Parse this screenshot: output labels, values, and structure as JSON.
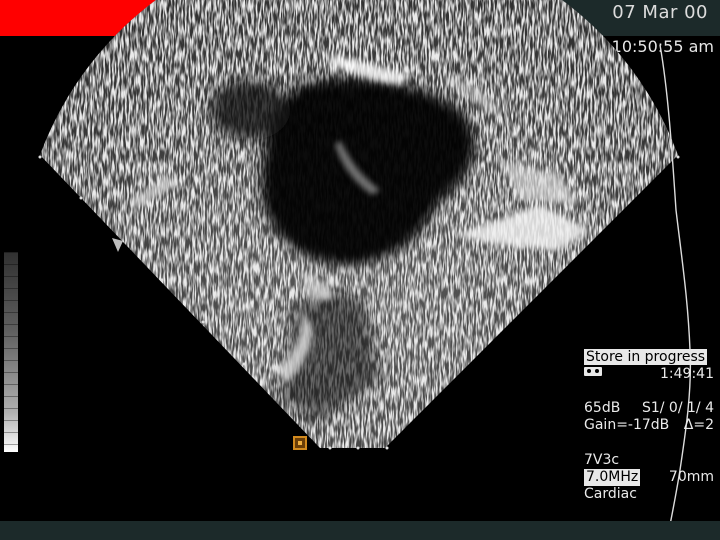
{
  "header": {
    "date": "07 Mar 00",
    "time": "10:50:55 am"
  },
  "status": {
    "store_label": "Store in progress",
    "tape_icon": "tape-icon",
    "elapsed": "1:49:41"
  },
  "params": {
    "dynamic_range": "65dB",
    "setting": "S1/ 0/ 1/ 4",
    "gain": "Gain=-17dB",
    "delta": "Δ=2"
  },
  "probe": {
    "name": "7V3c",
    "frequency": "7.0MHz",
    "depth": "70mm",
    "application": "Cardiac"
  },
  "icons": {
    "orientation_marker": "orientation-marker-icon",
    "grey_scale": "grey-scale-bar"
  },
  "colors": {
    "top_bar_red": "#ff0000",
    "bar_dark": "#1c2a2a",
    "marker_orange": "#d28a1e"
  }
}
